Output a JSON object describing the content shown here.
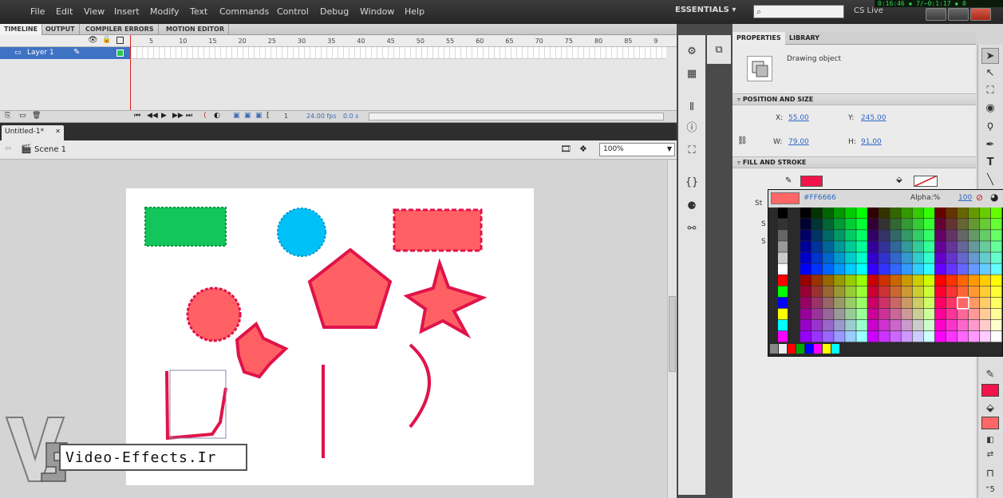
{
  "menu": {
    "items": [
      "File",
      "Edit",
      "View",
      "Insert",
      "Modify",
      "Text",
      "Commands",
      "Control",
      "Debug",
      "Window",
      "Help"
    ],
    "workspace": "ESSENTIALS ▾",
    "search_placeholder": "",
    "cs_live": "CS Live",
    "clock": "0:16:46 ▪ 7/−0:1:17 ▪ 0"
  },
  "timeline": {
    "tabs": [
      "TIMELINE",
      "OUTPUT",
      "COMPILER ERRORS",
      "MOTION EDITOR"
    ],
    "frame_numbers": [
      "5",
      "10",
      "15",
      "20",
      "25",
      "30",
      "35",
      "40",
      "45",
      "50",
      "55",
      "60",
      "65",
      "70",
      "75",
      "80",
      "85",
      "9"
    ],
    "layer_name": "Layer 1",
    "current_frame": "1",
    "fps": "24.00 fps",
    "elapsed": "0.0 s"
  },
  "document": {
    "tab": "Untitled-1*",
    "scene": "Scene 1",
    "zoom": "100%"
  },
  "properties": {
    "tabs": [
      "PROPERTIES",
      "LIBRARY"
    ],
    "object_type": "Drawing object",
    "position_size_title": "POSITION AND SIZE",
    "x_label": "X:",
    "x_value": "55.00",
    "y_label": "Y:",
    "y_value": "245.00",
    "w_label": "W:",
    "w_value": "79.00",
    "h_label": "H:",
    "h_value": "91.00",
    "fill_stroke_title": "FILL AND STROKE",
    "stroke_letter": "St",
    "s1": "S",
    "s2": "S"
  },
  "color_picker": {
    "hex": "#FF6666",
    "alpha_label": "Alpha:%",
    "alpha_value": "100",
    "selected_color": "#ff6666"
  },
  "colors": {
    "green_rect": "#12c65b",
    "cyan_circle": "#00c0f8",
    "salmon": "#ff6064",
    "crimson": "#e0134a",
    "stroke_swatch": "#f2134a"
  },
  "watermark": {
    "text": "Video-Effects.Ir"
  }
}
